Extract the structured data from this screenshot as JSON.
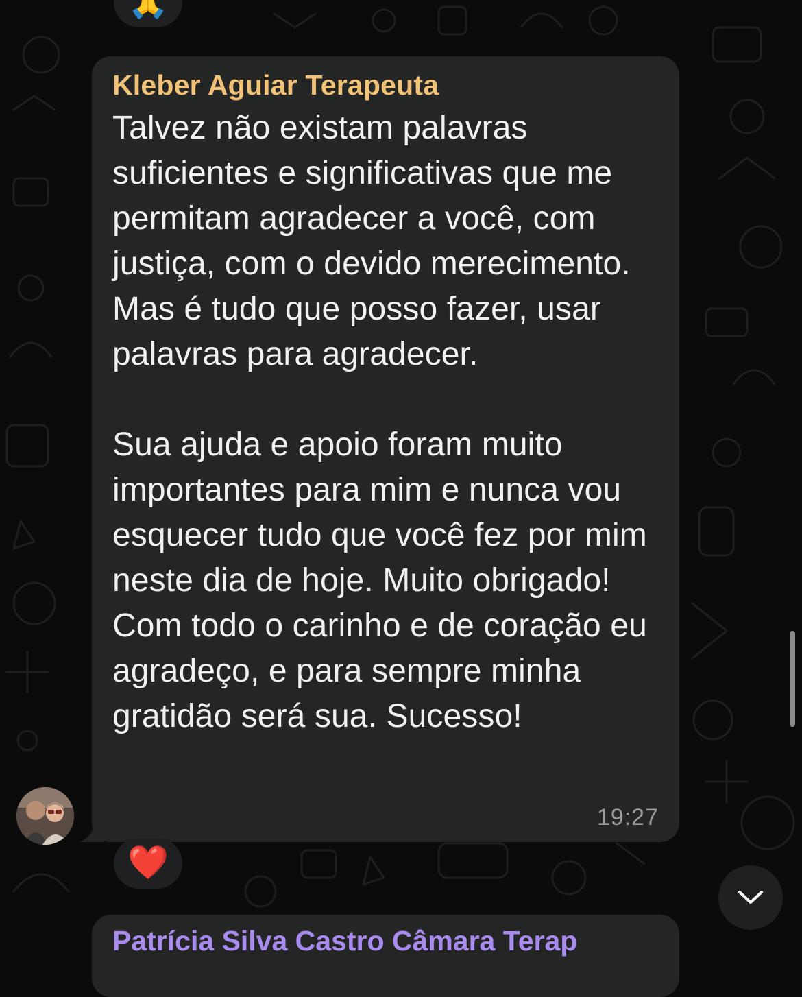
{
  "chat": {
    "top_reaction": {
      "emoji": "🙏",
      "icon": "folded-hands-icon"
    },
    "message": {
      "sender": "Kleber Aguiar Terapeuta",
      "sender_color": "#f2c277",
      "text": "Talvez não existam palavras suficientes e significativas que me permitam agradecer a você, com justiça, com o devido merecimento. Mas é tudo que posso fazer, usar palavras para agradecer.\n\nSua ajuda e apoio foram muito importantes para mim e nunca vou esquecer tudo que você fez por mim neste dia de hoje. Muito obrigado! Com todo o carinho e de coração eu agradeço, e para sempre minha gratidão será sua. Sucesso!",
      "time": "19:27",
      "reaction": {
        "emoji": "❤️",
        "icon": "red-heart-icon"
      }
    },
    "next_message": {
      "sender": "Patrícia Silva Castro Câmara Terap",
      "sender_color": "#a98bf0"
    },
    "scroll_down_icon": "chevron-down-icon",
    "colors": {
      "background": "#0b0b0b",
      "bubble": "#242626",
      "text": "#f1f1f1",
      "timestamp": "#9c9c9c"
    }
  }
}
